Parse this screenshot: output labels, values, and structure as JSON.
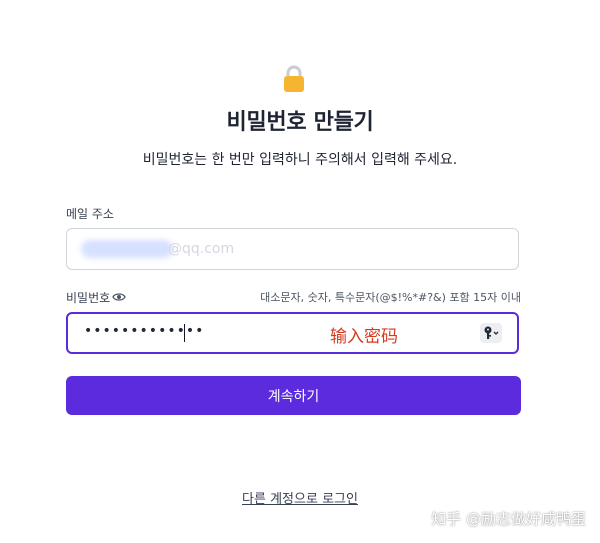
{
  "header": {
    "icon": "lock-icon",
    "title": "비밀번호 만들기",
    "subtitle": "비밀번호는 한 번만 입력하니 주의해서 입력해 주세요."
  },
  "email": {
    "label": "메일 주소",
    "value": "@qq.com"
  },
  "password": {
    "label": "비밀번호",
    "toggle_icon": "eye-icon",
    "hint": "대소문자, 숫자, 특수문자(@$!%*#?&) 포함 15자 이내",
    "masked_value": "•••••••••••••",
    "overlay_annotation": "输入密码",
    "key_icon": "key-icon"
  },
  "actions": {
    "continue_label": "계속하기",
    "login_link": "다른 계정으로 로그인"
  },
  "watermark": "知乎 @励志做好咸鸭蛋",
  "colors": {
    "accent": "#5b2bdd",
    "lock": "#f6b531",
    "annotation": "#d63a1f"
  }
}
